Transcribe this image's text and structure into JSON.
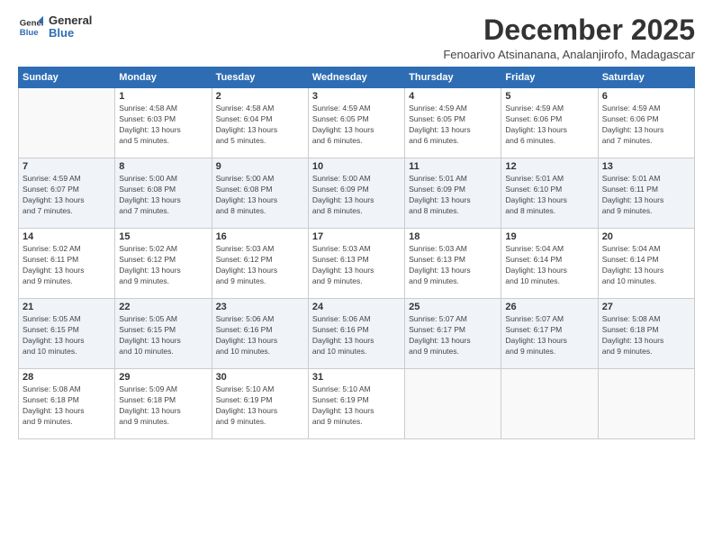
{
  "logo": {
    "line1": "General",
    "line2": "Blue"
  },
  "title": "December 2025",
  "location": "Fenoarivo Atsinanana, Analanjirofo, Madagascar",
  "headers": [
    "Sunday",
    "Monday",
    "Tuesday",
    "Wednesday",
    "Thursday",
    "Friday",
    "Saturday"
  ],
  "weeks": [
    [
      {
        "day": "",
        "info": ""
      },
      {
        "day": "1",
        "info": "Sunrise: 4:58 AM\nSunset: 6:03 PM\nDaylight: 13 hours\nand 5 minutes."
      },
      {
        "day": "2",
        "info": "Sunrise: 4:58 AM\nSunset: 6:04 PM\nDaylight: 13 hours\nand 5 minutes."
      },
      {
        "day": "3",
        "info": "Sunrise: 4:59 AM\nSunset: 6:05 PM\nDaylight: 13 hours\nand 6 minutes."
      },
      {
        "day": "4",
        "info": "Sunrise: 4:59 AM\nSunset: 6:05 PM\nDaylight: 13 hours\nand 6 minutes."
      },
      {
        "day": "5",
        "info": "Sunrise: 4:59 AM\nSunset: 6:06 PM\nDaylight: 13 hours\nand 6 minutes."
      },
      {
        "day": "6",
        "info": "Sunrise: 4:59 AM\nSunset: 6:06 PM\nDaylight: 13 hours\nand 7 minutes."
      }
    ],
    [
      {
        "day": "7",
        "info": "Sunrise: 4:59 AM\nSunset: 6:07 PM\nDaylight: 13 hours\nand 7 minutes."
      },
      {
        "day": "8",
        "info": "Sunrise: 5:00 AM\nSunset: 6:08 PM\nDaylight: 13 hours\nand 7 minutes."
      },
      {
        "day": "9",
        "info": "Sunrise: 5:00 AM\nSunset: 6:08 PM\nDaylight: 13 hours\nand 8 minutes."
      },
      {
        "day": "10",
        "info": "Sunrise: 5:00 AM\nSunset: 6:09 PM\nDaylight: 13 hours\nand 8 minutes."
      },
      {
        "day": "11",
        "info": "Sunrise: 5:01 AM\nSunset: 6:09 PM\nDaylight: 13 hours\nand 8 minutes."
      },
      {
        "day": "12",
        "info": "Sunrise: 5:01 AM\nSunset: 6:10 PM\nDaylight: 13 hours\nand 8 minutes."
      },
      {
        "day": "13",
        "info": "Sunrise: 5:01 AM\nSunset: 6:11 PM\nDaylight: 13 hours\nand 9 minutes."
      }
    ],
    [
      {
        "day": "14",
        "info": "Sunrise: 5:02 AM\nSunset: 6:11 PM\nDaylight: 13 hours\nand 9 minutes."
      },
      {
        "day": "15",
        "info": "Sunrise: 5:02 AM\nSunset: 6:12 PM\nDaylight: 13 hours\nand 9 minutes."
      },
      {
        "day": "16",
        "info": "Sunrise: 5:03 AM\nSunset: 6:12 PM\nDaylight: 13 hours\nand 9 minutes."
      },
      {
        "day": "17",
        "info": "Sunrise: 5:03 AM\nSunset: 6:13 PM\nDaylight: 13 hours\nand 9 minutes."
      },
      {
        "day": "18",
        "info": "Sunrise: 5:03 AM\nSunset: 6:13 PM\nDaylight: 13 hours\nand 9 minutes."
      },
      {
        "day": "19",
        "info": "Sunrise: 5:04 AM\nSunset: 6:14 PM\nDaylight: 13 hours\nand 10 minutes."
      },
      {
        "day": "20",
        "info": "Sunrise: 5:04 AM\nSunset: 6:14 PM\nDaylight: 13 hours\nand 10 minutes."
      }
    ],
    [
      {
        "day": "21",
        "info": "Sunrise: 5:05 AM\nSunset: 6:15 PM\nDaylight: 13 hours\nand 10 minutes."
      },
      {
        "day": "22",
        "info": "Sunrise: 5:05 AM\nSunset: 6:15 PM\nDaylight: 13 hours\nand 10 minutes."
      },
      {
        "day": "23",
        "info": "Sunrise: 5:06 AM\nSunset: 6:16 PM\nDaylight: 13 hours\nand 10 minutes."
      },
      {
        "day": "24",
        "info": "Sunrise: 5:06 AM\nSunset: 6:16 PM\nDaylight: 13 hours\nand 10 minutes."
      },
      {
        "day": "25",
        "info": "Sunrise: 5:07 AM\nSunset: 6:17 PM\nDaylight: 13 hours\nand 9 minutes."
      },
      {
        "day": "26",
        "info": "Sunrise: 5:07 AM\nSunset: 6:17 PM\nDaylight: 13 hours\nand 9 minutes."
      },
      {
        "day": "27",
        "info": "Sunrise: 5:08 AM\nSunset: 6:18 PM\nDaylight: 13 hours\nand 9 minutes."
      }
    ],
    [
      {
        "day": "28",
        "info": "Sunrise: 5:08 AM\nSunset: 6:18 PM\nDaylight: 13 hours\nand 9 minutes."
      },
      {
        "day": "29",
        "info": "Sunrise: 5:09 AM\nSunset: 6:18 PM\nDaylight: 13 hours\nand 9 minutes."
      },
      {
        "day": "30",
        "info": "Sunrise: 5:10 AM\nSunset: 6:19 PM\nDaylight: 13 hours\nand 9 minutes."
      },
      {
        "day": "31",
        "info": "Sunrise: 5:10 AM\nSunset: 6:19 PM\nDaylight: 13 hours\nand 9 minutes."
      },
      {
        "day": "",
        "info": ""
      },
      {
        "day": "",
        "info": ""
      },
      {
        "day": "",
        "info": ""
      }
    ]
  ]
}
